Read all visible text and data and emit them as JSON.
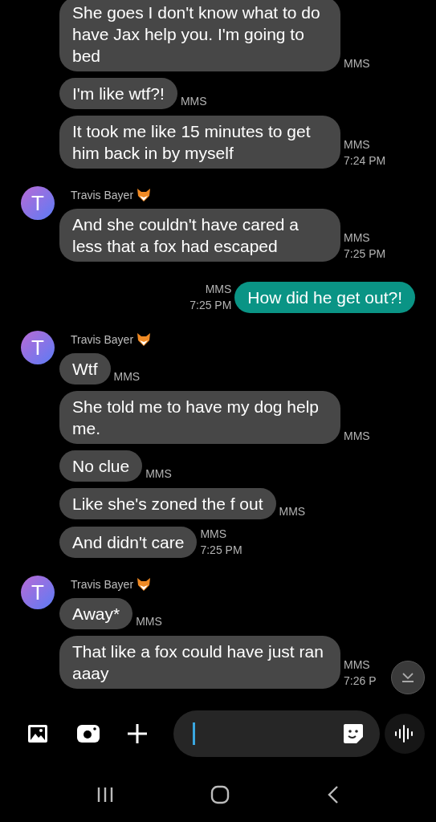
{
  "conversation": [
    {
      "kind": "incoming",
      "messages": [
        {
          "text": "She goes I don't know what to do have Jax help you. I'm going to bed",
          "meta": [
            "MMS"
          ]
        },
        {
          "text": "I'm like wtf?!",
          "meta": [
            "MMS"
          ]
        },
        {
          "text": "It took me like 15 minutes to get him back in by myself",
          "meta": [
            "MMS",
            "7:24 PM"
          ]
        }
      ]
    },
    {
      "kind": "incoming",
      "sender": "Travis Bayer",
      "avatar": "T",
      "messages": [
        {
          "text": "And she couldn't have cared a less that a fox had escaped",
          "meta": [
            "MMS",
            "7:25 PM"
          ]
        }
      ]
    },
    {
      "kind": "outgoing",
      "messages": [
        {
          "text": "How did he get out?!",
          "meta": [
            "MMS",
            "7:25 PM"
          ]
        }
      ]
    },
    {
      "kind": "incoming",
      "sender": "Travis Bayer",
      "avatar": "T",
      "messages": [
        {
          "text": "Wtf",
          "meta": [
            "MMS"
          ]
        },
        {
          "text": "She told me to have my dog help me.",
          "meta": [
            "MMS"
          ]
        },
        {
          "text": "No clue",
          "meta": [
            "MMS"
          ]
        },
        {
          "text": "Like she's zoned the f out",
          "meta": [
            "MMS"
          ]
        },
        {
          "text": "And didn't care",
          "meta": [
            "MMS",
            "7:25 PM"
          ]
        }
      ]
    },
    {
      "kind": "incoming",
      "sender": "Travis Bayer",
      "avatar": "T",
      "messages": [
        {
          "text": "Away*",
          "meta": [
            "MMS"
          ]
        },
        {
          "text": "That like a fox could have just ran aaay",
          "meta": [
            "MMS",
            "7:26 P"
          ]
        }
      ]
    }
  ]
}
